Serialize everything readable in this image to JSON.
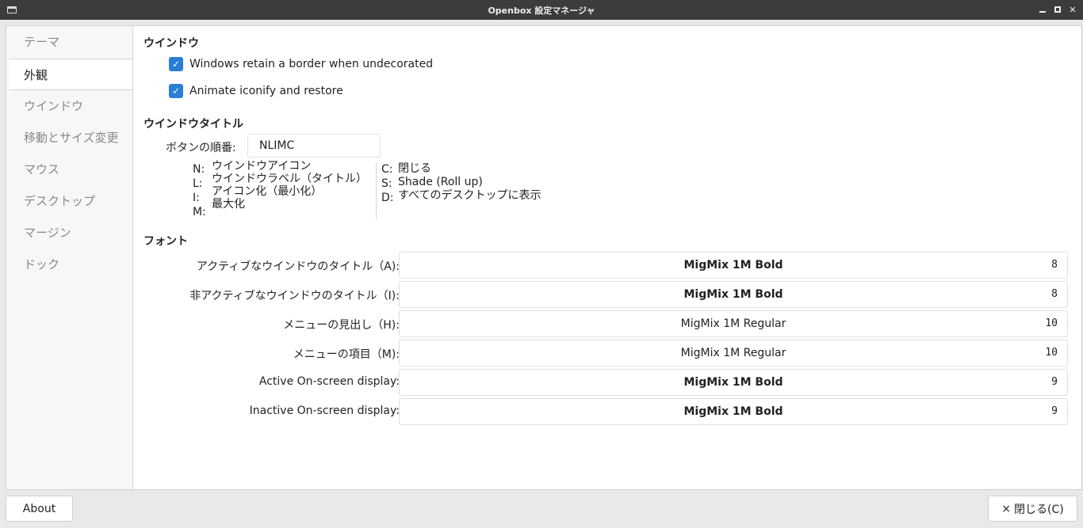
{
  "window": {
    "title": "Openbox 設定マネージャ"
  },
  "sidebar": {
    "items": [
      {
        "label": "テーマ"
      },
      {
        "label": "外観"
      },
      {
        "label": "ウインドウ"
      },
      {
        "label": "移動とサイズ変更"
      },
      {
        "label": "マウス"
      },
      {
        "label": "デスクトップ"
      },
      {
        "label": "マージン"
      },
      {
        "label": "ドック"
      }
    ],
    "active_index": 1
  },
  "windows_section": {
    "title": "ウインドウ",
    "options": [
      {
        "label": "Windows retain a border when undecorated",
        "checked": true
      },
      {
        "label": "Animate iconify and restore",
        "checked": true
      }
    ]
  },
  "titlebar_section": {
    "title": "ウインドウタイトル",
    "order_label": "ボタンの順番:",
    "order_value": "NLIMC",
    "legend_left": [
      {
        "key": "N:",
        "value": "ウインドウアイコン"
      },
      {
        "key": "L:",
        "value": "ウインドウラベル（タイトル）"
      },
      {
        "key": "I:",
        "value": "アイコン化（最小化）"
      },
      {
        "key": "M:",
        "value": "最大化"
      }
    ],
    "legend_right": [
      {
        "key": "C:",
        "value": "閉じる"
      },
      {
        "key": "S:",
        "value": "Shade (Roll up)"
      },
      {
        "key": "D:",
        "value": "すべてのデスクトップに表示"
      }
    ]
  },
  "font_section": {
    "title": "フォント",
    "rows": [
      {
        "label": "アクティブなウインドウのタイトル（A):",
        "font": "MigMix 1M Bold",
        "size": "8",
        "bold": true
      },
      {
        "label": "非アクティブなウインドウのタイトル（I):",
        "font": "MigMix 1M Bold",
        "size": "8",
        "bold": true
      },
      {
        "label": "メニューの見出し（H):",
        "font": "MigMix 1M Regular",
        "size": "10",
        "bold": false
      },
      {
        "label": "メニューの項目（M):",
        "font": "MigMix 1M Regular",
        "size": "10",
        "bold": false
      },
      {
        "label": "Active On-screen display:",
        "font": "MigMix 1M Bold",
        "size": "9",
        "bold": true
      },
      {
        "label": "Inactive On-screen display:",
        "font": "MigMix 1M Bold",
        "size": "9",
        "bold": true
      }
    ]
  },
  "footer": {
    "about_label": "About",
    "close_label": "閉じる(C)",
    "close_icon": "×"
  },
  "colors": {
    "accent": "#2a7fd4",
    "titlebar": "#3c3c3c"
  }
}
